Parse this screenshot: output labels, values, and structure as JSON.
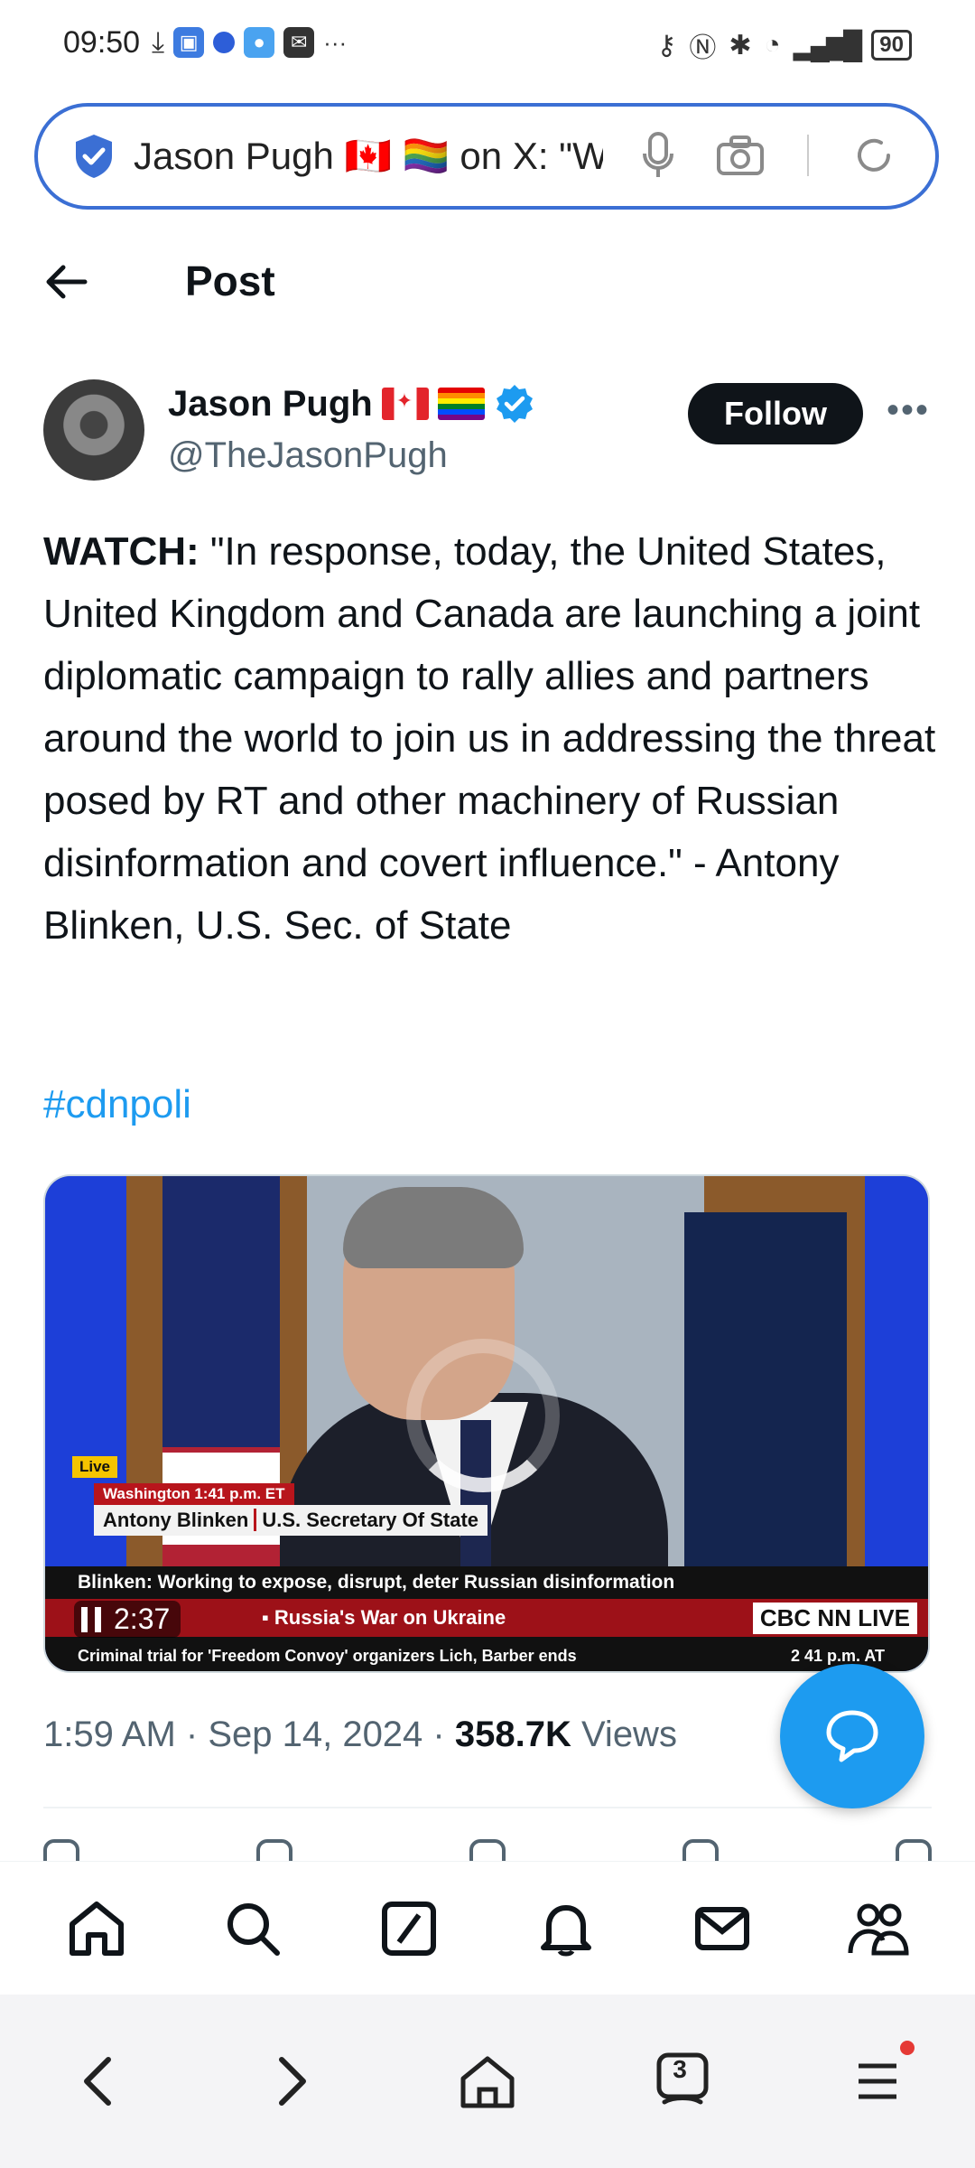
{
  "status_bar": {
    "time": "09:50",
    "battery": "90",
    "more": "···"
  },
  "browser": {
    "address_text": "Jason Pugh 🇨🇦 🏳️‍🌈 on X: \"W",
    "tabs_count": "3",
    "accent_color": "#3b6fd4"
  },
  "header": {
    "title": "Post"
  },
  "author": {
    "display_name": "Jason Pugh",
    "handle": "@TheJasonPugh",
    "follow_label": "Follow",
    "more_label": "•••"
  },
  "tweet": {
    "lead": "WATCH:",
    "body": " \"In response, today, the United States, United Kingdom and Canada are launching a joint diplomatic campaign to rally allies and partners around the world to join us in addressing the threat posed by RT and other machinery of Russian disinformation and covert influence.\" - Antony Blinken, U.S. Sec. of State",
    "hashtag": "#cdnpoli"
  },
  "video": {
    "live_badge": "Live",
    "location": "Washington  1:41 p.m. ET",
    "name": "Antony Blinken",
    "title": "U.S. Secretary Of State",
    "ticker_headline": "Blinken: Working to expose, disrupt, deter Russian disinformation",
    "ticker_segment": "▪ Russia's War on Ukraine",
    "network": "CBC NN LIVE",
    "ticker_bottom": "Criminal trial for 'Freedom Convoy' organizers Lich, Barber ends",
    "ticker_time": "2 41 p.m. AT",
    "duration": "2:37"
  },
  "meta": {
    "time": "1:59 AM",
    "date": "Sep 14, 2024",
    "views_count": "358.7K",
    "views_label": "Views",
    "separator": " · "
  },
  "colors": {
    "brand_blue": "#1d9bf0",
    "text_primary": "#0f1419",
    "text_secondary": "#536471"
  }
}
